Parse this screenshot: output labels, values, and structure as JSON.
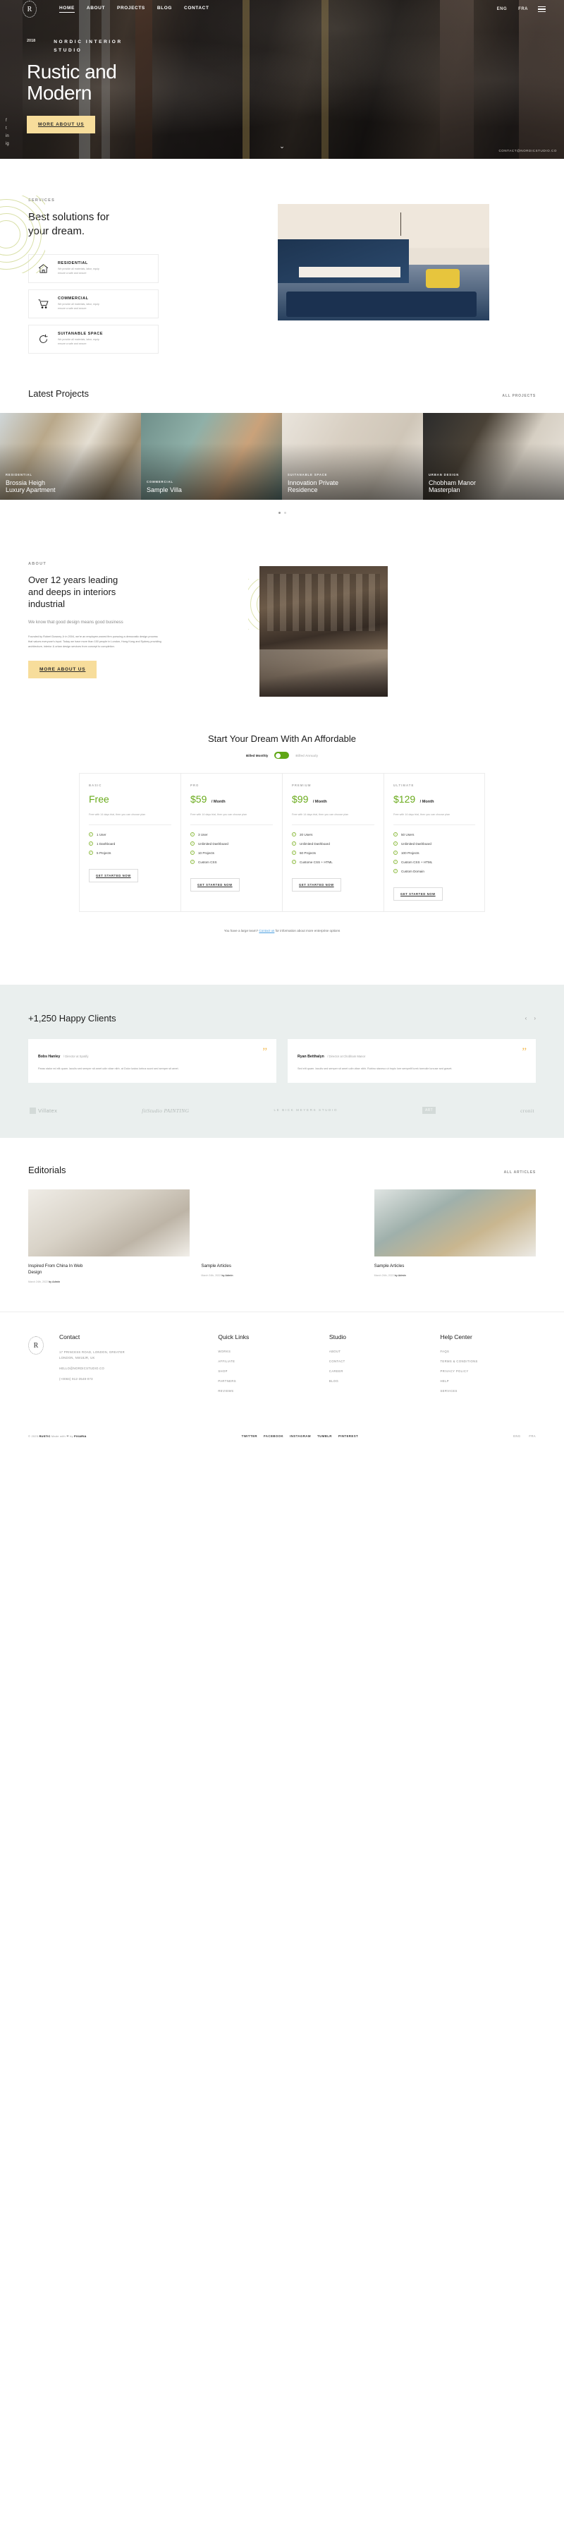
{
  "header": {
    "logo_letter": "R",
    "nav": [
      {
        "label": "HOME",
        "active": true
      },
      {
        "label": "ABOUT",
        "active": false
      },
      {
        "label": "PROJECTS",
        "active": false
      },
      {
        "label": "BLOG",
        "active": false
      },
      {
        "label": "CONTACT",
        "active": false
      }
    ],
    "lang": [
      {
        "label": "ENG"
      },
      {
        "label": "FRA"
      }
    ]
  },
  "hero": {
    "year": "2018",
    "eyebrow": "NORDIC INTERIOR STUDIO",
    "title_line1": "Rustic and",
    "title_line2": "Modern",
    "cta": "MORE ABOUT US",
    "right_label": "CONTACT@NORDICSTUDIO.CO",
    "social": [
      "f",
      "t",
      "in",
      "ig"
    ],
    "scroll": "⌄"
  },
  "services": {
    "kicker": "SERVICES",
    "heading_line1": "Best solutions for",
    "heading_line2": "your dream.",
    "items": [
      {
        "icon": "home-icon",
        "title": "RESIDENTIAL",
        "desc_line1": "We provide all materials, labor, equip",
        "desc_line2": "ensure a safe and secure"
      },
      {
        "icon": "cart-icon",
        "title": "COMMERCIAL",
        "desc_line1": "We provide all materials, labor, equip",
        "desc_line2": "ensure a safe and secure"
      },
      {
        "icon": "refresh-icon",
        "title": "SUITANABLE SPACE",
        "desc_line1": "We provide all materials, labor, equip",
        "desc_line2": "ensure a safe and secure"
      }
    ]
  },
  "projects": {
    "heading": "Latest Projects",
    "all_link": "ALL PROJECTS",
    "items": [
      {
        "category": "RESIDENTIAL",
        "name_line1": "Brossia Heigh",
        "name_line2": "Luxury Apartment"
      },
      {
        "category": "COMMERCIAL",
        "name_line1": "Sample Villa",
        "name_line2": ""
      },
      {
        "category": "SUITANABLE SPACE",
        "name_line1": "Innovation Private",
        "name_line2": "Residence"
      },
      {
        "category": "URBAN DESIGN",
        "name_line1": "Chobham Manor",
        "name_line2": "Masterplan"
      }
    ]
  },
  "about": {
    "kicker": "ABOUT",
    "heading_line1": "Over 12 years leading",
    "heading_line2": "and deeps in interiors",
    "heading_line3": "industrial",
    "subtitle": "We know that good design means good business",
    "body": "Founded by Robert Downey Jr in 2004, we're an employee-owned firm pursuing a democratic design process that values everyone's input. Today we have more than 150 people in London, Hong Kong and Sydney providing architecture, interior & urban design services from concept to completion.",
    "cta": "MORE ABOUT US"
  },
  "pricing": {
    "heading": "Start Your Dream With An Affordable",
    "toggle_monthly": "Billed Monthly",
    "toggle_annually": "Billed Annualy",
    "plans": [
      {
        "tier": "BASIC",
        "price": "Free",
        "per": "",
        "note": "Free with 14 days trial, then you can choose plan",
        "features": [
          "1 User",
          "1 Dashboard",
          "5 Projects"
        ],
        "cta": "GET STARTED NOW"
      },
      {
        "tier": "PRO",
        "price": "$59",
        "per": "/ Month",
        "note": "Free with 14 days trial, then you can choose plan",
        "features": [
          "3 User",
          "Unlimited Dashboard",
          "10 Projects",
          "Custom CSS"
        ],
        "cta": "GET STARTED NOW"
      },
      {
        "tier": "PREMIUM",
        "price": "$99",
        "per": "/ Month",
        "note": "Free with 14 days trial, then you can choose plan",
        "features": [
          "20 Users",
          "Unlimited Dashboard",
          "50 Projects",
          "Custome CSS + HTML"
        ],
        "cta": "GET STARTED NOW"
      },
      {
        "tier": "ULTIMATE",
        "price": "$129",
        "per": "/ Month",
        "note": "Free with 14 days trial, then you can choose plan",
        "features": [
          "50 Users",
          "Unlimited Dashboard",
          "100 Projects",
          "Custom CSS + HTML",
          "Custom Domain"
        ],
        "cta": "GET STARTED NOW"
      }
    ],
    "enterprise_pre": "You have a large team? ",
    "enterprise_link": "Contact us",
    "enterprise_post": " for information about more enterprise options"
  },
  "clients": {
    "heading": "+1,250 Happy Clients",
    "prev": "‹",
    "next": "›",
    "testimonials": [
      {
        "name": "Bobs Hanley",
        "role": "/ Director at Spotify",
        "text": "Paras stalor ed elit quam. Iaculis sed semper sit amet udin vitae nibh. at Dolor lustos lorbus sconi sed semper sit amet."
      },
      {
        "name": "Ryan Betthalyn",
        "role": "/ Director at Chobham Manor",
        "text": "Sed elit quam. Iaculis sed semper sit amet udin vitae nibh. Rubino staveuo ut tropic lore sempelif lurek tormoile lurcuse sed gravet."
      }
    ],
    "brands": [
      "Villatex",
      "fitStudio PAINTING",
      "LE BICK MEYERS STUDIO",
      "ART",
      "cronit"
    ]
  },
  "editorials": {
    "heading": "Editorials",
    "all_link": "ALL ARTICLES",
    "articles": [
      {
        "title_line1": "Inspired From China In Web",
        "title_line2": "Design",
        "date": "March 24th, 2022",
        "by": "by Admin"
      },
      {
        "title_line1": "Sample Articles",
        "title_line2": "",
        "date": "March 24th, 2022",
        "by": "by Admin"
      },
      {
        "title_line1": "Sample Articles",
        "title_line2": "",
        "date": "March 24th, 2022",
        "by": "by Admin"
      }
    ]
  },
  "footer": {
    "logo_letter": "R",
    "contact": {
      "heading": "Contact",
      "address_line1": "17 PRINCESS ROAD, LONDON, GREATER",
      "address_line2": "LONDON, NW18JR, UK",
      "email": "HELLO@NORDICSTUDIO.CO",
      "phone": "(+0084) 912-3548-073"
    },
    "quick_links": {
      "heading": "Quick Links",
      "items": [
        "WORKS",
        "AFFILIATE",
        "SHOP",
        "PARTNERS",
        "REVIEWS"
      ]
    },
    "studio": {
      "heading": "Studio",
      "items": [
        "ABOUT",
        "CONTACT",
        "CAREER",
        "BLOG"
      ]
    },
    "help": {
      "heading": "Help Center",
      "items": [
        "FAQS",
        "TERMS & CONDITIONS",
        "PRIVACY POLICY",
        "HELP",
        "SERVICES"
      ]
    },
    "copyright_pre": "© 2025 ",
    "copyright_brand": "RUSTIC",
    "copyright_mid": " Made with ❤ by ",
    "copyright_author": "PIXARIA",
    "social": [
      "TWITTER",
      "FACEBOOK",
      "INSTAGRAM",
      "TUMBLR",
      "PINTEREST"
    ],
    "lang": [
      "ENG",
      "FRA"
    ]
  }
}
